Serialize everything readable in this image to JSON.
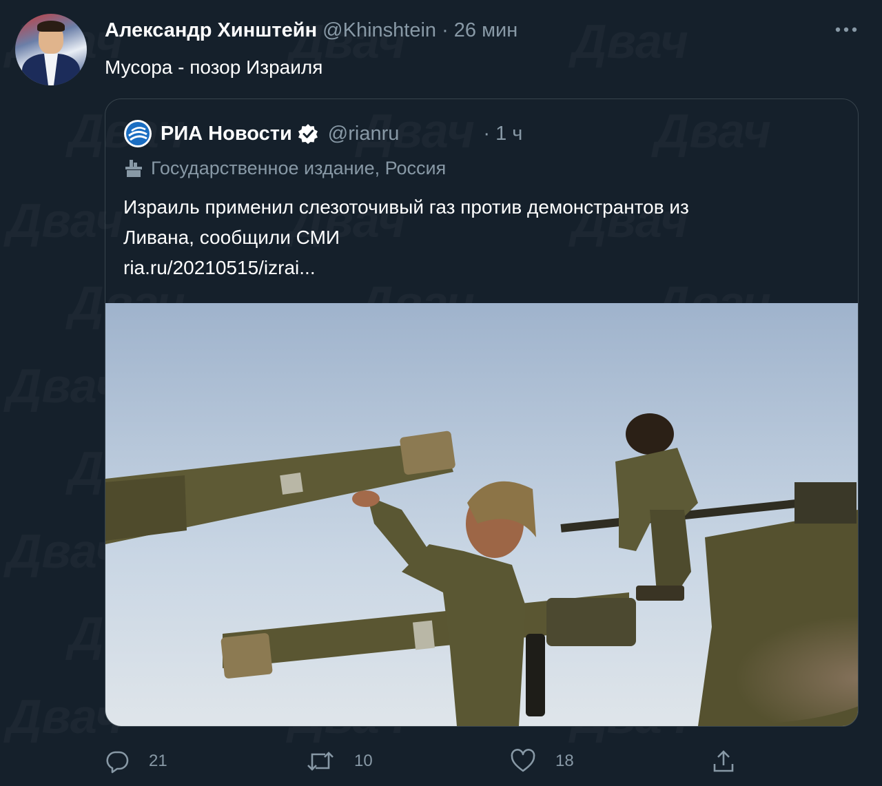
{
  "watermark": "Двач",
  "tweet": {
    "author_name": "Александр Хинштейн",
    "author_handle": "@Khinshtein",
    "time": "· 26 мин",
    "text": "Мусора - позор Израиля"
  },
  "quoted": {
    "author_name": "РИА Новости",
    "author_handle": "@rianru",
    "time": "· 1 ч",
    "state_label": "Государственное издание, Россия",
    "text_line1": "Израиль применил слезоточивый газ против демонстрантов из",
    "text_line2": "Ливана, сообщили СМИ",
    "link": "ria.ru/20210515/izrai..."
  },
  "actions": {
    "reply_count": "21",
    "retweet_count": "10",
    "like_count": "18"
  },
  "colors": {
    "background": "#15202b",
    "muted": "#8899a6",
    "border": "#38444d",
    "verified": "#1da1f2"
  },
  "icons": [
    "more-icon",
    "ria-logo-icon",
    "verified-icon",
    "state-media-icon",
    "reply-icon",
    "retweet-icon",
    "like-icon",
    "share-icon"
  ]
}
